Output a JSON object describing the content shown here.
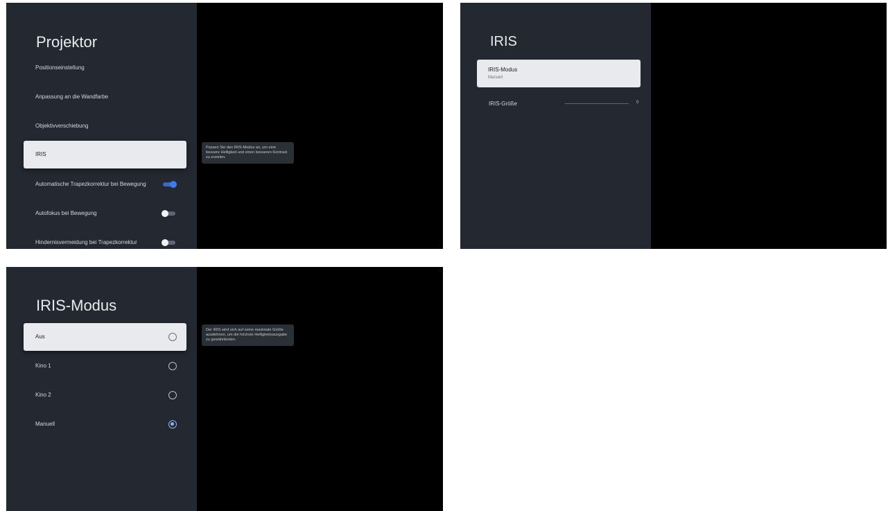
{
  "screen1": {
    "title": "Projektor",
    "items": [
      {
        "label": "Positionseinstellung"
      },
      {
        "label": "Anpassung an die Wandfarbe"
      },
      {
        "label": "Objektivverschiebung"
      },
      {
        "label": "IRIS"
      },
      {
        "label": "Automatische Trapezkorrektur bei Bewegung",
        "toggle": "on"
      },
      {
        "label": "Autofokus bei Bewegung",
        "toggle": "off"
      },
      {
        "label": "Hindernisvermeidung bei Trapezkorrektur",
        "toggle": "off"
      }
    ],
    "tooltip": "Passen Sie den IRIS-Modus an, um eine bessere Helligkeit und einen besseren Kontrast zu erzielen."
  },
  "screen2": {
    "title": "IRIS",
    "mode_label": "IRIS-Modus",
    "mode_value": "Manuell",
    "size_label": "IRIS-Größe",
    "size_value": "0",
    "size_level": 0
  },
  "screen3": {
    "title": "IRIS-Modus",
    "options": [
      {
        "label": "Aus",
        "selected": false
      },
      {
        "label": "Kino 1",
        "selected": false
      },
      {
        "label": "Kino 2",
        "selected": false
      },
      {
        "label": "Manuell",
        "selected": true
      }
    ],
    "tooltip": "Der IRIS wird sich auf seine maximale Größe ausdehnen, um die höchste Helligkeitsausgabe zu gewährleisten."
  },
  "colors": {
    "panel_bg": "#232831",
    "focus_bg": "#e9eaed",
    "accent": "#3f7ce8",
    "radio_selected": "#8ab4f8"
  }
}
